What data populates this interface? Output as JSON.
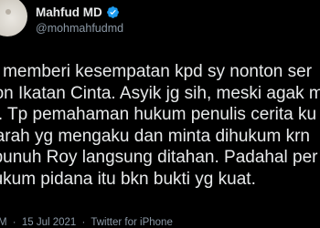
{
  "author": {
    "display_name": "Mahfud MD",
    "handle": "@mohmahfudmd",
    "verified_icon": "verified-badge-icon"
  },
  "tweet": {
    "lines": [
      "M memberi kesempatan kpd sy nonton ser",
      "tron Ikatan Cinta. Asyik jg sih, meski agak m",
      "er. Tp pemahaman hukum penulis cerita ku",
      "Sarah yg mengaku dan minta dihukum krn",
      "nbunuh Roy langsung ditahan. Padahal per",
      "hukum pidana itu bkn bukti yg kuat."
    ]
  },
  "meta": {
    "time": "M",
    "separator": "·",
    "date": "15 Jul 2021",
    "source": "Twitter for iPhone"
  },
  "colors": {
    "background": "#000000",
    "text": "#e7e9ea",
    "secondary": "#8b98a5",
    "verified": "#1d9bf0"
  }
}
